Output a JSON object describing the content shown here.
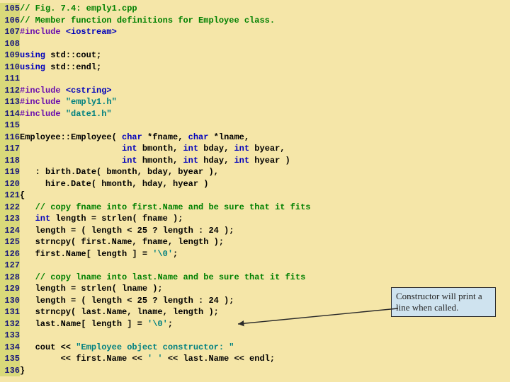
{
  "callout": {
    "text": "Constructor will print a line when called."
  },
  "lines": [
    {
      "num": "105",
      "tokens": [
        [
          "c",
          "// Fig. 7.4: emply1.cpp"
        ]
      ]
    },
    {
      "num": "106",
      "tokens": [
        [
          "c",
          "// Member function definitions for Employee class."
        ]
      ]
    },
    {
      "num": "107",
      "tokens": [
        [
          "p",
          "#include "
        ],
        [
          "k",
          "<iostream>"
        ]
      ]
    },
    {
      "num": "108",
      "tokens": []
    },
    {
      "num": "109",
      "tokens": [
        [
          "k",
          "using"
        ],
        [
          "n",
          " std::cout;"
        ]
      ]
    },
    {
      "num": "110",
      "tokens": [
        [
          "k",
          "using"
        ],
        [
          "n",
          " std::endl;"
        ]
      ]
    },
    {
      "num": "111",
      "tokens": []
    },
    {
      "num": "112",
      "tokens": [
        [
          "p",
          "#include "
        ],
        [
          "k",
          "<cstring>"
        ]
      ]
    },
    {
      "num": "113",
      "tokens": [
        [
          "p",
          "#include "
        ],
        [
          "s",
          "\"emply1.h\""
        ]
      ]
    },
    {
      "num": "114",
      "tokens": [
        [
          "p",
          "#include "
        ],
        [
          "s",
          "\"date1.h\""
        ]
      ]
    },
    {
      "num": "115",
      "tokens": []
    },
    {
      "num": "116",
      "tokens": [
        [
          "n",
          "Employee::Employee( "
        ],
        [
          "t",
          "char"
        ],
        [
          "n",
          " *fname, "
        ],
        [
          "t",
          "char"
        ],
        [
          "n",
          " *lname,"
        ]
      ]
    },
    {
      "num": "117",
      "tokens": [
        [
          "n",
          "                    "
        ],
        [
          "t",
          "int"
        ],
        [
          "n",
          " bmonth, "
        ],
        [
          "t",
          "int"
        ],
        [
          "n",
          " bday, "
        ],
        [
          "t",
          "int"
        ],
        [
          "n",
          " byear,"
        ]
      ]
    },
    {
      "num": "118",
      "tokens": [
        [
          "n",
          "                    "
        ],
        [
          "t",
          "int"
        ],
        [
          "n",
          " hmonth, "
        ],
        [
          "t",
          "int"
        ],
        [
          "n",
          " hday, "
        ],
        [
          "t",
          "int"
        ],
        [
          "n",
          " hyear )"
        ]
      ]
    },
    {
      "num": "119",
      "tokens": [
        [
          "n",
          "   : birth.Date( bmonth, bday, byear ),"
        ]
      ]
    },
    {
      "num": "120",
      "tokens": [
        [
          "n",
          "     hire.Date( hmonth, hday, hyear )"
        ]
      ]
    },
    {
      "num": "121",
      "tokens": [
        [
          "n",
          "{"
        ]
      ]
    },
    {
      "num": "122",
      "tokens": [
        [
          "n",
          "   "
        ],
        [
          "c",
          "// copy fname into first.Name and be sure that it fits"
        ]
      ]
    },
    {
      "num": "123",
      "tokens": [
        [
          "n",
          "   "
        ],
        [
          "t",
          "int"
        ],
        [
          "n",
          " length = strlen( fname );"
        ]
      ]
    },
    {
      "num": "124",
      "tokens": [
        [
          "n",
          "   length = ( length < 25 ? length : 24 );"
        ]
      ]
    },
    {
      "num": "125",
      "tokens": [
        [
          "n",
          "   strncpy( first.Name, fname, length );"
        ]
      ]
    },
    {
      "num": "126",
      "tokens": [
        [
          "n",
          "   first.Name[ length ] = "
        ],
        [
          "ch",
          "'\\0'"
        ],
        [
          "n",
          ";"
        ]
      ]
    },
    {
      "num": "127",
      "tokens": []
    },
    {
      "num": "128",
      "tokens": [
        [
          "n",
          "   "
        ],
        [
          "c",
          "// copy lname into last.Name and be sure that it fits"
        ]
      ]
    },
    {
      "num": "129",
      "tokens": [
        [
          "n",
          "   length = strlen( lname );"
        ]
      ]
    },
    {
      "num": "130",
      "tokens": [
        [
          "n",
          "   length = ( length < 25 ? length : 24 );"
        ]
      ]
    },
    {
      "num": "131",
      "tokens": [
        [
          "n",
          "   strncpy( last.Name, lname, length );"
        ]
      ]
    },
    {
      "num": "132",
      "tokens": [
        [
          "n",
          "   last.Name[ length ] = "
        ],
        [
          "ch",
          "'\\0'"
        ],
        [
          "n",
          ";"
        ]
      ]
    },
    {
      "num": "133",
      "tokens": []
    },
    {
      "num": "134",
      "tokens": [
        [
          "n",
          "   cout << "
        ],
        [
          "s",
          "\"Employee object constructor: \""
        ]
      ]
    },
    {
      "num": "135",
      "tokens": [
        [
          "n",
          "        << first.Name << "
        ],
        [
          "ch",
          "' '"
        ],
        [
          "n",
          " << last.Name << endl;"
        ]
      ]
    },
    {
      "num": "136",
      "tokens": [
        [
          "n",
          "}"
        ]
      ]
    }
  ]
}
